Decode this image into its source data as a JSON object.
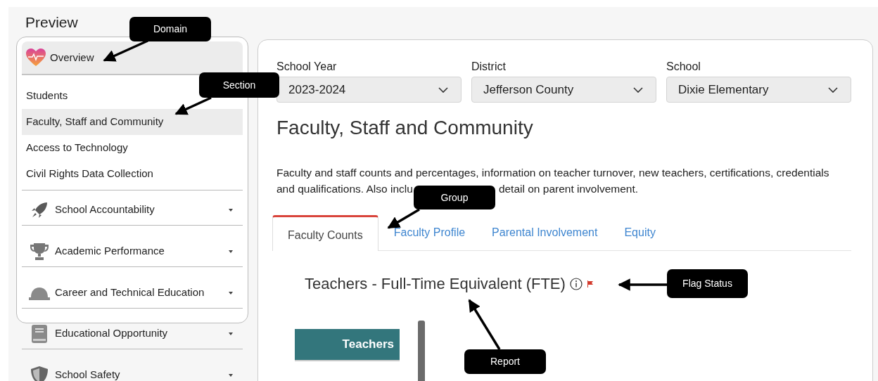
{
  "title": "Preview",
  "sidebar": {
    "framed_domains": [
      {
        "label": "Overview",
        "expanded": true,
        "sections": [
          {
            "label": "Students",
            "selected": false
          },
          {
            "label": "Faculty, Staff and Community",
            "selected": true
          },
          {
            "label": "Access to Technology",
            "selected": false
          },
          {
            "label": "Civil Rights Data Collection",
            "selected": false
          }
        ]
      },
      {
        "label": "School Accountability",
        "expanded": false
      },
      {
        "label": "Academic Performance",
        "expanded": false
      },
      {
        "label": "Career and Technical Education",
        "expanded": false
      }
    ],
    "domains": [
      {
        "label": "Educational Opportunity",
        "expanded": false
      },
      {
        "label": "School Safety",
        "expanded": false
      }
    ]
  },
  "filters": [
    {
      "label": "School Year",
      "value": "2023-2024"
    },
    {
      "label": "District",
      "value": "Jefferson County"
    },
    {
      "label": "School",
      "value": "Dixie Elementary"
    }
  ],
  "heading": "Faculty, Staff and Community",
  "description": {
    "line_1": "Faculty and staff counts and percentages, information on teacher turnover, new teachers, certifications, credentials",
    "line_2_start": "and qualifications. Also inclu",
    "line_2_end": "detail on parent involvement."
  },
  "tabs": [
    {
      "label": "Faculty Counts",
      "selected": true
    },
    {
      "label": "Faculty Profile",
      "selected": false
    },
    {
      "label": "Parental Involvement",
      "selected": false
    },
    {
      "label": "Equity",
      "selected": false
    }
  ],
  "report": {
    "title": "Teachers - Full-Time Equivalent (FTE)",
    "flagged": true,
    "bars": [
      {
        "label": "Teachers"
      }
    ]
  },
  "annotations": [
    {
      "text": "Domain"
    },
    {
      "text": "Section"
    },
    {
      "text": "Group"
    },
    {
      "text": "Flag Status"
    },
    {
      "text": "Report"
    }
  ]
}
